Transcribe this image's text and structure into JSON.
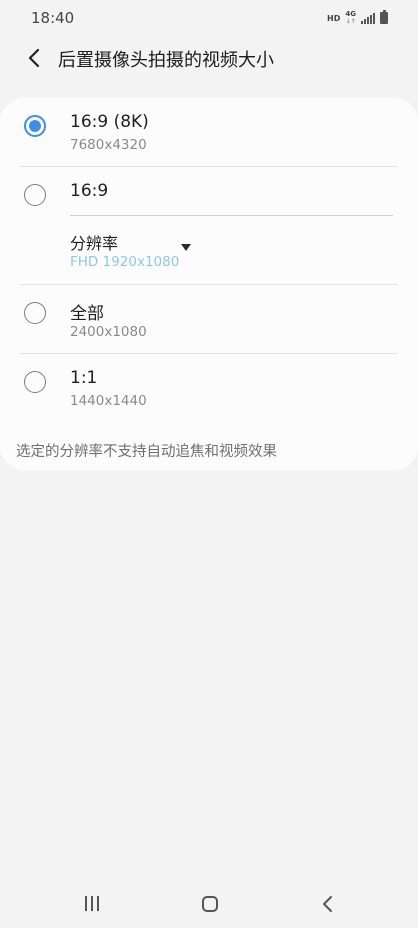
{
  "status_bar": {
    "time": "18:40",
    "hd": "HD",
    "network": "4G",
    "network_arrows": "↓↑"
  },
  "header": {
    "title": "后置摄像头拍摄的视频大小",
    "back_icon": "chevron-left-icon"
  },
  "options": [
    {
      "title": "16:9 (8K)",
      "subtitle": "7680x4320",
      "selected": true
    },
    {
      "title": "16:9",
      "selected": false,
      "dropdown": {
        "label": "分辨率",
        "value": "FHD 1920x1080"
      }
    },
    {
      "title": "全部",
      "subtitle": "2400x1080",
      "selected": false
    },
    {
      "title": "1:1",
      "subtitle": "1440x1440",
      "selected": false
    }
  ],
  "footnote": "选定的分辨率不支持自动追焦和视频效果",
  "colors": {
    "accent": "#3e8ee8",
    "dropdown_value": "#8cc8ea",
    "background": "#f3f3f3",
    "card": "#fcfcfc"
  },
  "nav_bar": {
    "recents_icon": "recents-icon",
    "home_icon": "home-icon",
    "back_icon": "back-icon"
  }
}
